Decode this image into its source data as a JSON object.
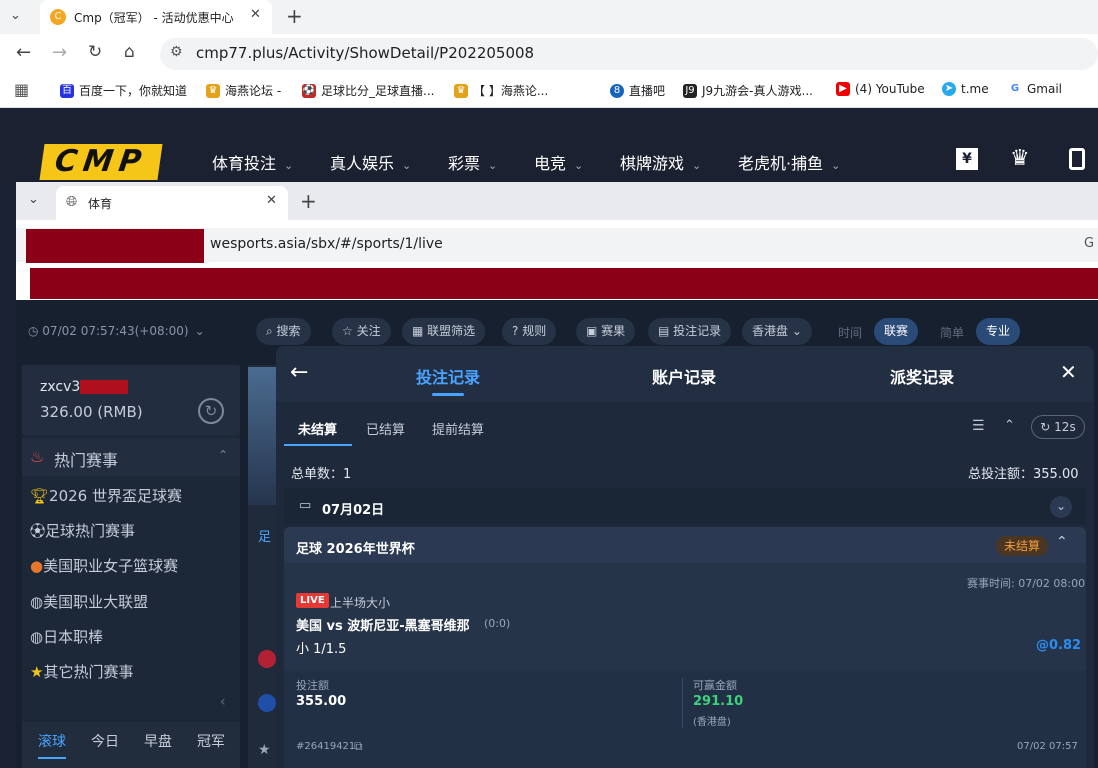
{
  "outer_browser": {
    "tab_title": "Cmp（冠军） - 活动优惠中心",
    "url": "cmp77.plus/Activity/ShowDetail/P202205008",
    "bookmarks": [
      "百度一下，你就知道",
      "海燕论坛 -",
      "足球比分_足球直播...",
      "【      】海燕论...",
      "直播吧",
      "J9九游会-真人游戏...",
      "(4) YouTube",
      "t.me",
      "Gmail"
    ]
  },
  "site_header": {
    "logo": "CMP",
    "nav": [
      "体育投注",
      "真人娱乐",
      "彩票",
      "电竞",
      "棋牌游戏",
      "老虎机·捕鱼"
    ]
  },
  "inner_browser": {
    "tab_title": "体育",
    "url": "wesports.asia/sbx/#/sports/1/live"
  },
  "toolbar": {
    "time": "07/02 07:57:43(+08:00)",
    "buttons": [
      "搜索",
      "关注",
      "联盟筛选",
      "规则",
      "赛果",
      "投注记录",
      "香港盘"
    ],
    "modes": [
      "时间",
      "联赛"
    ],
    "views": [
      "简单",
      "专业"
    ]
  },
  "left_panel": {
    "username": "zxcv3",
    "balance": "326.00 (RMB)",
    "hot_title": "热门赛事",
    "items": [
      "2026 世界盃足球赛",
      "足球热门赛事",
      "美国职业女子篮球赛",
      "美国职业大联盟",
      "日本职棒",
      "其它热门赛事"
    ],
    "bottom_tabs": [
      "滚球",
      "今日",
      "早盘",
      "冠军"
    ],
    "mid_label": "足"
  },
  "modal": {
    "tabs": [
      "投注记录",
      "账户记录",
      "派奖记录"
    ],
    "subtabs": [
      "未结算",
      "已结算",
      "提前结算"
    ],
    "refresh": "12s",
    "total_orders_label": "总单数：",
    "total_orders": "1",
    "total_stake_label": "总投注额：",
    "total_stake": "355.00",
    "date": "07月02日",
    "card": {
      "league": "足球 2026年世界杯",
      "status": "未结算",
      "match_time": "赛事时间: 07/02 08:00",
      "live_badge": "LIVE",
      "market": "上半场大小",
      "match": "美国 vs 波斯尼亚-黑塞哥维那",
      "score": "(0:0)",
      "selection": "小 1/1.5",
      "odds": "@0.82",
      "stake_label": "投注额",
      "stake": "355.00",
      "win_label": "可赢金额",
      "win": "291.10",
      "odds_type": "(香港盘)",
      "ticket": "#26419421",
      "bet_time": "07/02 07:57"
    }
  },
  "colors": {
    "accent": "#2d8cf0",
    "win": "#3fd17c",
    "live": "#e53935",
    "logo": "#f5c518",
    "status": "#f39c3c"
  }
}
